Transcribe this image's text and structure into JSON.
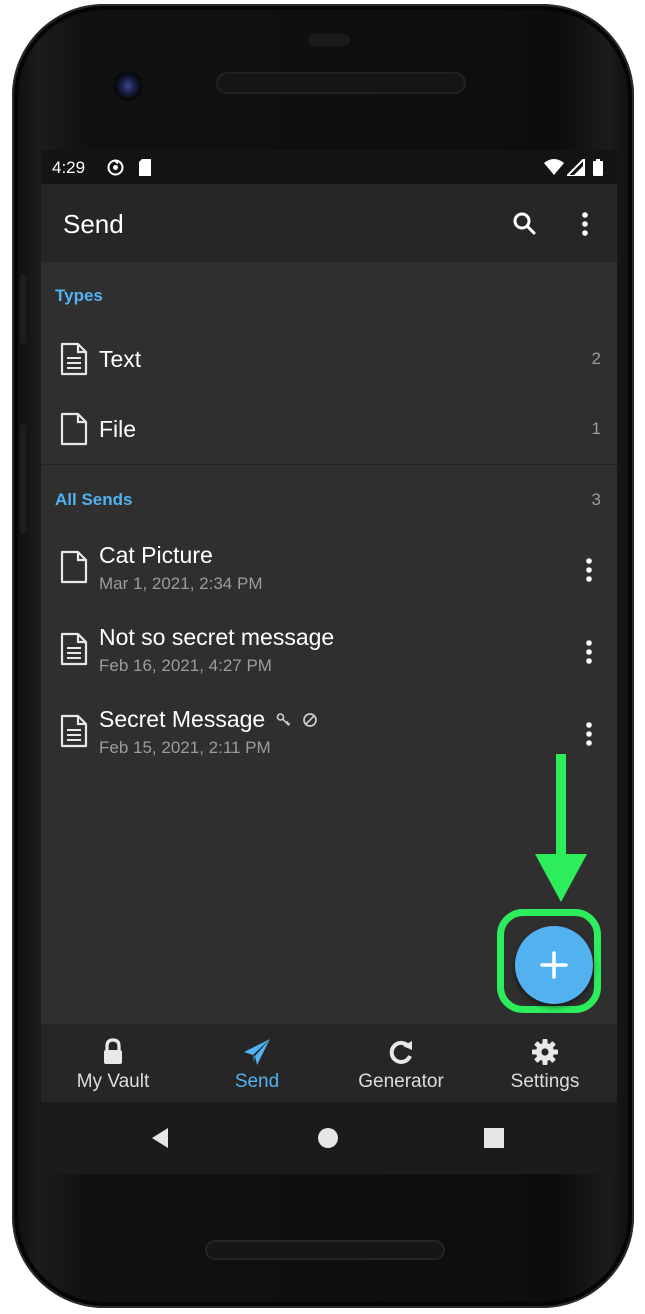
{
  "status_bar": {
    "time": "4:29",
    "left_icons": [
      "sync-icon",
      "sd-card-icon"
    ],
    "right_icons": [
      "wifi-icon",
      "signal-icon",
      "battery-icon"
    ]
  },
  "app_bar": {
    "title": "Send",
    "actions": [
      "search-icon",
      "more-vert-icon"
    ]
  },
  "types_section": {
    "label": "Types",
    "items": [
      {
        "label": "Text",
        "count": "2",
        "icon": "text-document-icon"
      },
      {
        "label": "File",
        "count": "1",
        "icon": "file-icon"
      }
    ]
  },
  "sends_section": {
    "label": "All Sends",
    "count": "3",
    "items": [
      {
        "title": "Cat Picture",
        "date": "Mar 1, 2021, 2:34 PM",
        "icon": "file-icon",
        "badges": []
      },
      {
        "title": "Not so secret message",
        "date": "Feb 16, 2021, 4:27 PM",
        "icon": "text-document-icon",
        "badges": []
      },
      {
        "title": "Secret Message",
        "date": "Feb 15, 2021, 2:11 PM",
        "icon": "text-document-icon",
        "badges": [
          "key-icon",
          "disabled-icon"
        ]
      }
    ]
  },
  "fab": {
    "icon": "plus-icon",
    "accent": "#52b2f0",
    "highlight_color": "#2ded5c"
  },
  "bottom_nav": {
    "items": [
      {
        "label": "My Vault",
        "icon": "lock-icon",
        "active": false
      },
      {
        "label": "Send",
        "icon": "paper-plane-icon",
        "active": true
      },
      {
        "label": "Generator",
        "icon": "refresh-icon",
        "active": false
      },
      {
        "label": "Settings",
        "icon": "gear-icon",
        "active": false
      }
    ]
  },
  "system_nav": [
    "back-icon",
    "home-icon",
    "recents-icon"
  ],
  "colors": {
    "accent": "#52b2f0",
    "background": "#2f2f2f",
    "bar": "#262626",
    "arrow": "#2ded5c"
  }
}
